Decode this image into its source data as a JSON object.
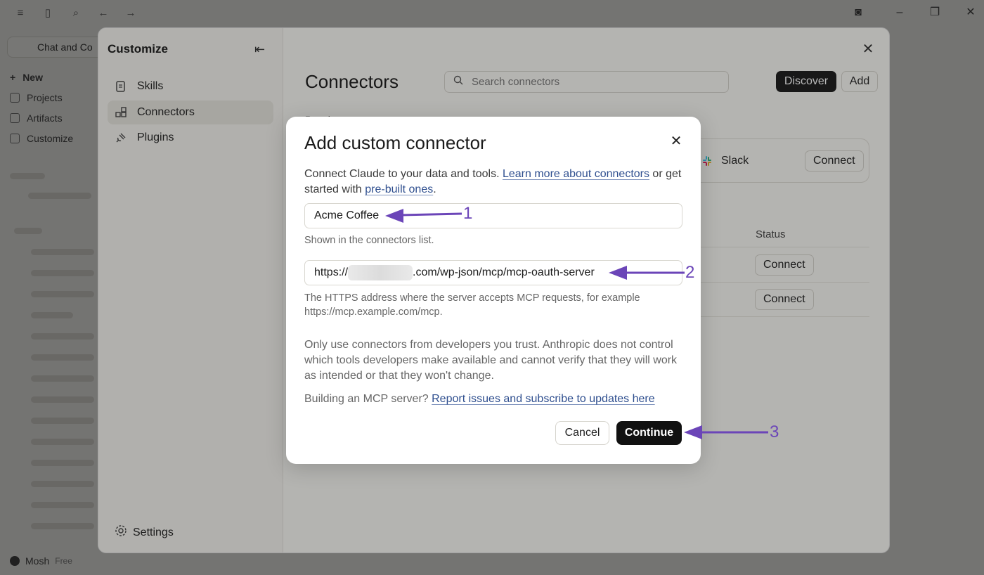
{
  "app": {
    "chat_label": "Chat and Co",
    "nav": [
      {
        "label": "New"
      },
      {
        "label": "Projects"
      },
      {
        "label": "Artifacts"
      },
      {
        "label": "Customize"
      }
    ],
    "user_name": "Mosh",
    "user_plan": "Free"
  },
  "customize": {
    "title": "Customize",
    "items": [
      {
        "label": "Skills",
        "icon": "scroll-icon"
      },
      {
        "label": "Connectors",
        "icon": "connectors-icon"
      },
      {
        "label": "Plugins",
        "icon": "plug-icon"
      }
    ],
    "active_item": "Connectors",
    "settings_label": "Settings"
  },
  "connectors_page": {
    "heading": "Connectors",
    "search_placeholder": "Search connectors",
    "discover_label": "Discover",
    "add_label": "Add",
    "popular_label": "Popular",
    "featured": {
      "name": "Slack",
      "action": "Connect"
    },
    "status_header": "Status",
    "rows": [
      {
        "action": "Connect"
      },
      {
        "action": "Connect"
      }
    ]
  },
  "modal": {
    "title": "Add custom connector",
    "intro_text_1": "Connect Claude to your data and tools. ",
    "intro_link_1": "Learn more about connectors",
    "intro_text_2": " or get started with ",
    "intro_link_2": "pre-built ones",
    "intro_text_3": ".",
    "name_value": "Acme Coffee",
    "name_hint": "Shown in the connectors list.",
    "url_prefix": "https://",
    "url_suffix": ".com/wp-json/mcp/mcp-oauth-server",
    "url_hint": "The HTTPS address where the server accepts MCP requests, for example https://mcp.example.com/mcp.",
    "warning": "Only use connectors from developers you trust. Anthropic does not control which tools developers make available and cannot verify that they will work as intended or that they won't change.",
    "building_text": "Building an MCP server? ",
    "building_link": "Report issues and subscribe to updates here",
    "cancel_label": "Cancel",
    "continue_label": "Continue"
  },
  "annotations": [
    {
      "number": "1"
    },
    {
      "number": "2"
    },
    {
      "number": "3"
    }
  ],
  "colors": {
    "annotation": "#6b45b8",
    "link": "#2f4f8f",
    "primary_button": "#111111"
  }
}
